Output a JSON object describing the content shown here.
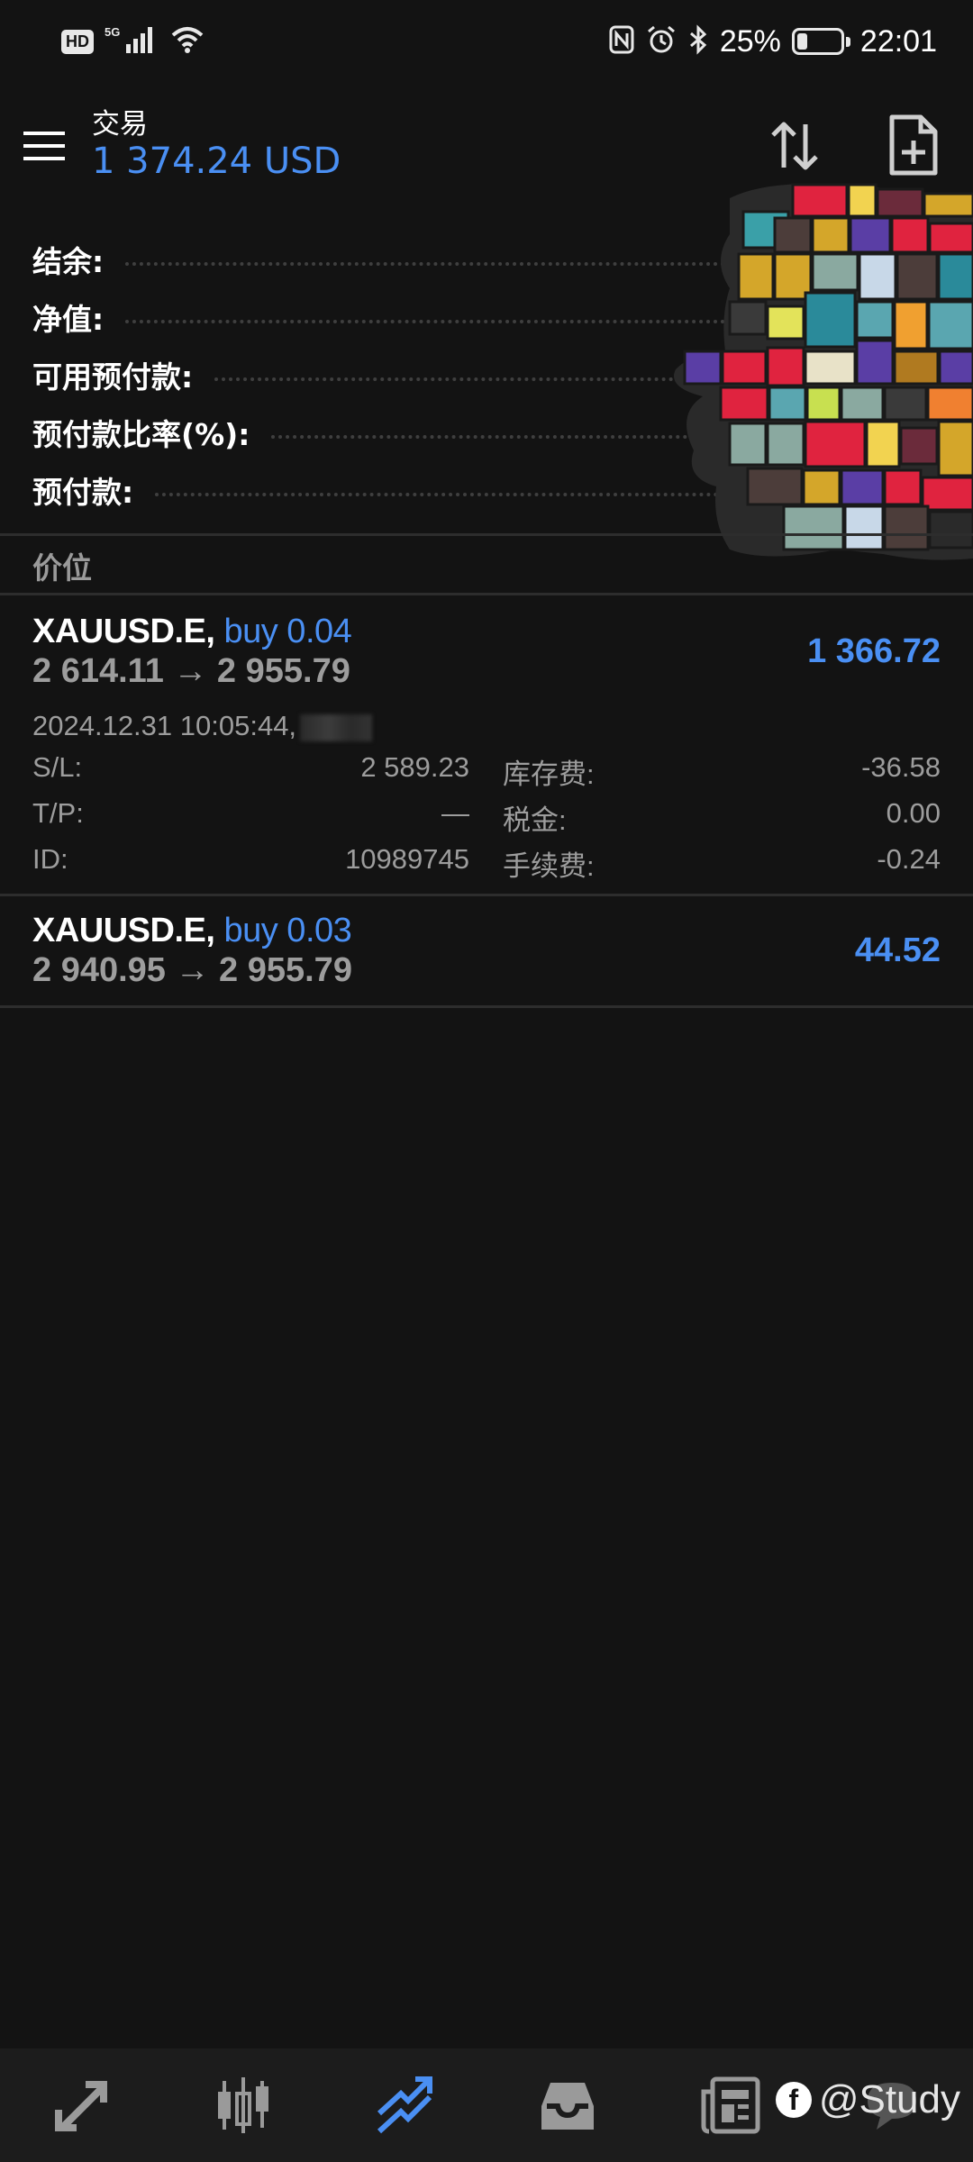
{
  "status_bar": {
    "hd": "HD",
    "network": "5G",
    "battery_pct": "25%",
    "battery_level": 0.25,
    "time": "22:01"
  },
  "header": {
    "title": "交易",
    "balance": "1 374.24 USD"
  },
  "summary": [
    {
      "label": "结余:"
    },
    {
      "label": "净值:"
    },
    {
      "label": "可用预付款:"
    },
    {
      "label": "预付款比率(%):"
    },
    {
      "label": "预付款:"
    }
  ],
  "section_header": "价位",
  "positions": [
    {
      "symbol": "XAUUSD.E,",
      "side": "buy 0.04",
      "prices": "2 614.11 → 2 955.79",
      "profit": "1 366.72",
      "time": "2024.12.31 10:05:44,",
      "details": [
        {
          "label1": "S/L:",
          "value1": "2 589.23",
          "label2": "库存费:",
          "value2": "-36.58"
        },
        {
          "label1": "T/P:",
          "value1": "—",
          "label2": "税金:",
          "value2": "0.00"
        },
        {
          "label1": "ID:",
          "value1": "10989745",
          "label2": "手续费:",
          "value2": "-0.24"
        }
      ]
    },
    {
      "symbol": "XAUUSD.E,",
      "side": "buy 0.03",
      "prices": "2 940.95 → 2 955.79",
      "profit": "44.52"
    }
  ],
  "bottom_nav": [
    {
      "icon": "trade-arrows-icon",
      "active": false
    },
    {
      "icon": "chart-candles-icon",
      "active": false
    },
    {
      "icon": "trade-chart-icon",
      "active": true
    },
    {
      "icon": "inbox-icon",
      "active": false
    },
    {
      "icon": "news-icon",
      "active": false
    },
    {
      "icon": "chat-icon",
      "active": false
    }
  ],
  "watermark": "@Study",
  "colors": {
    "background": "#131313",
    "accent": "#4a8ff3",
    "muted": "#9d9d9d",
    "nav_bg": "#1c1c1c"
  }
}
